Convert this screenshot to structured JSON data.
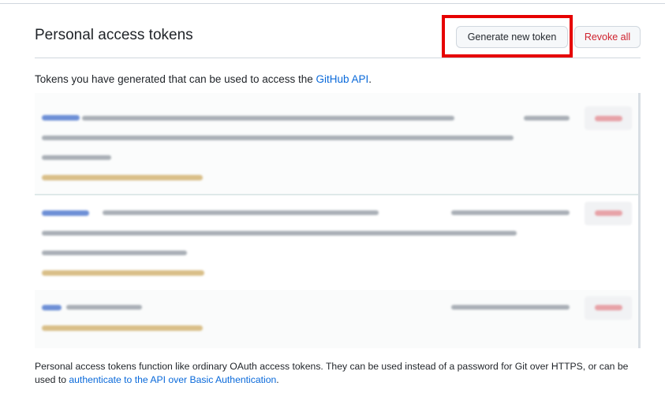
{
  "header": {
    "title": "Personal access tokens",
    "generate_label": "Generate new token",
    "revoke_all_label": "Revoke all"
  },
  "intro": {
    "text": "Tokens you have generated that can be used to access the ",
    "link": "GitHub API",
    "suffix": "."
  },
  "tokens": [
    {
      "note": "redacted token (blurred)"
    },
    {
      "note": "redacted token (blurred)"
    },
    {
      "note": "redacted token (blurred)"
    }
  ],
  "footer": {
    "text": "Personal access tokens function like ordinary OAuth access tokens. They can be used instead of a password for Git over HTTPS, or can be used to ",
    "link": "authenticate to the API over Basic Authentication",
    "suffix": "."
  },
  "colors": {
    "link": "#0969da",
    "danger": "#cf222e",
    "highlight_box": "#e60000"
  }
}
